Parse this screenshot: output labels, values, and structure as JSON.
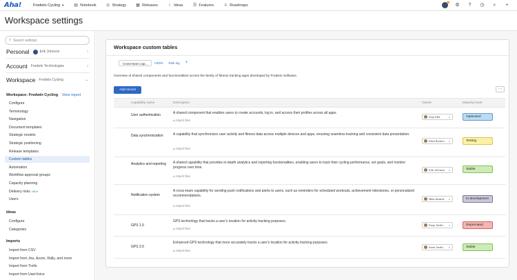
{
  "app": {
    "logo": "Aha!",
    "workspace": "Fredwin Cycling",
    "nav": [
      {
        "label": "Notebook",
        "icon": "notebook-icon",
        "glyph": "▤"
      },
      {
        "label": "Strategy",
        "icon": "strategy-icon",
        "glyph": "◎"
      },
      {
        "label": "Releases",
        "icon": "releases-icon",
        "glyph": "▦"
      },
      {
        "label": "Ideas",
        "icon": "ideas-icon",
        "glyph": "♀"
      },
      {
        "label": "Features",
        "icon": "features-icon",
        "glyph": "☰"
      },
      {
        "label": "Roadmaps",
        "icon": "roadmaps-icon",
        "glyph": "≡"
      }
    ]
  },
  "page": {
    "title": "Workspace settings"
  },
  "sidebar": {
    "search_placeholder": "Search settings",
    "personal": {
      "label": "Personal",
      "user": "Erik Johnson"
    },
    "account": {
      "label": "Account",
      "value": "Fredwin Technologies"
    },
    "workspace": {
      "label": "Workspace",
      "value": "Fredwin Cycling"
    },
    "workspace_group": {
      "title": "Workspace: Fredwin Cycling",
      "view_report": "View report"
    },
    "workspace_items": [
      {
        "label": "Configure"
      },
      {
        "label": "Terminology"
      },
      {
        "label": "Navigation"
      },
      {
        "label": "Document templates"
      },
      {
        "label": "Strategic models"
      },
      {
        "label": "Strategic positioning"
      },
      {
        "label": "Release templates"
      },
      {
        "label": "Custom tables",
        "active": true
      },
      {
        "label": "Automation"
      },
      {
        "label": "Workflow approval groups"
      },
      {
        "label": "Capacity planning"
      },
      {
        "label": "Delivery risks",
        "badge": "NEW"
      },
      {
        "label": "Users"
      }
    ],
    "ideas_group": {
      "title": "Ideas"
    },
    "ideas_items": [
      {
        "label": "Configure"
      },
      {
        "label": "Categories"
      }
    ],
    "imports_group": {
      "title": "Imports"
    },
    "imports_items": [
      {
        "label": "Import from CSV"
      },
      {
        "label": "Import from Jira, Azure, Rally, and more"
      },
      {
        "label": "Import from Trello"
      },
      {
        "label": "Import from UserVoice"
      }
    ]
  },
  "main": {
    "card_title": "Workspace custom tables",
    "tabs": [
      {
        "label": "Cross-team cap...",
        "active": true
      },
      {
        "label": "OKRs",
        "link": true
      },
      {
        "label": "Risk log",
        "link": true
      },
      {
        "label": "+",
        "plus": true
      }
    ],
    "overview": "Overview of shared components and functionalities across the family of fitness tracking apps developed by Fredwin Software.",
    "add_record": "Add record",
    "more": "···",
    "columns": {
      "name": "Capability name",
      "description": "Description",
      "owner": "Owner",
      "maturity": "Maturity level"
    },
    "attach_label": "Attach files",
    "remove_glyph": "x",
    "rows": [
      {
        "name": "User authentication",
        "description": "A shared component that enables users to create accounts, log in, and access their profiles across all apps.",
        "owner": "Amy Ellis",
        "maturity": "Optimized",
        "mat_bg": "#bcdcf4",
        "mat_border": "#5b9bd0"
      },
      {
        "name": "Data synchronization",
        "description": "A capability that synchronizes user activity and fitness data across multiple devices and apps, ensuring seamless tracking and consistent data presentation.",
        "owner": "Elliot Burden",
        "maturity": "Testing",
        "mat_bg": "#fbf1a6",
        "mat_border": "#d9c44a"
      },
      {
        "name": "Analytics and reporting",
        "description": "A shared capability that provides in-depth analytics and reporting functionalities, enabling users to track their cycling performance, set goals, and monitor progress over time.",
        "owner": "Erik Johnson",
        "maturity": "Stable",
        "mat_bg": "#cdebb6",
        "mat_border": "#84bf5c"
      },
      {
        "name": "Notification system",
        "description": "A cross-team capability for sending push notifications and alerts to users, such as reminders for scheduled workouts, achievement milestones, or personalized recommendations.",
        "owner": "Mike Alvarez",
        "maturity": "In development",
        "mat_bg": "#cbc6d8",
        "mat_border": "#7d7597"
      },
      {
        "name": "GPS 1.0",
        "description": "GPS technology that tracks a user's location for activity tracking purposes.",
        "owner": "Rose Smith",
        "maturity": "Deprecated",
        "mat_bg": "#f3b7b3",
        "mat_border": "#d0605a"
      },
      {
        "name": "GPS 2.0",
        "description": "Enhanced GPS technology that more accurately tracks a user's location for activity tracking purposes.",
        "owner": "Rose Smith",
        "maturity": "Stable",
        "mat_bg": "#cdebb6",
        "mat_border": "#84bf5c"
      }
    ]
  }
}
